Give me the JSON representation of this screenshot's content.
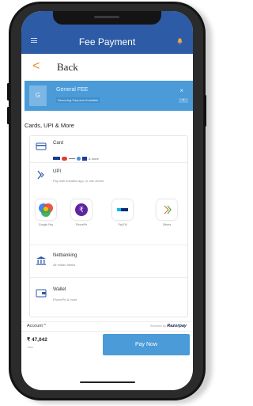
{
  "header": {
    "title": "Fee Payment"
  },
  "nav": {
    "back_label": "Back",
    "back_glyph": "<"
  },
  "fee": {
    "avatar_letter": "G",
    "title": "General FEE",
    "badge": "Recurring Payment Available",
    "close_glyph": "×",
    "mini": "₹"
  },
  "section": {
    "title": "Cards, UPI & More"
  },
  "methods": {
    "card": {
      "title": "Card",
      "more": "& more"
    },
    "upi": {
      "title": "UPI",
      "subtitle": "Pay with installed app, or use others",
      "apps": [
        {
          "label": "Google Pay",
          "color": "#e8453c"
        },
        {
          "label": "PhonePe",
          "color": "#5f259f"
        },
        {
          "label": "PayTM",
          "color": "#0b2a73"
        },
        {
          "label": "Others",
          "color": "#cc7c1f"
        }
      ]
    },
    "netbanking": {
      "title": "Netbanking",
      "subtitle": "All Indian banks"
    },
    "wallet": {
      "title": "Wallet",
      "subtitle": "PhonePe & more"
    }
  },
  "footer": {
    "account_label": "Account ^",
    "secured_prefix": "Secured by",
    "secured_brand": "Razorpay"
  },
  "pay": {
    "amount": "₹ 47,042",
    "fee_note": "+fee",
    "button_label": "Pay Now"
  },
  "colors": {
    "header": "#2d5ba5",
    "accent": "#4a9bd8",
    "back_arrow": "#ea8c2e"
  }
}
